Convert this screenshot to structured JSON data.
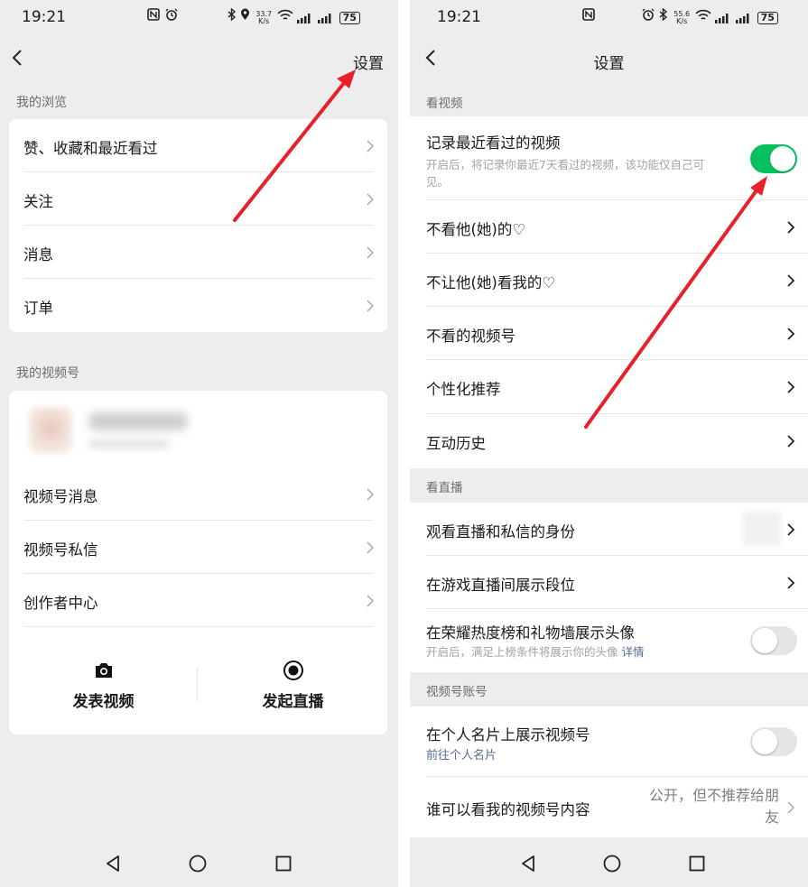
{
  "left": {
    "status": {
      "time": "19:21",
      "net_top": "33.7",
      "net_bottom": "K/s",
      "battery": "75"
    },
    "header": {
      "settings": "设置"
    },
    "browse": {
      "label": "我的浏览",
      "items": [
        {
          "label": "赞、收藏和最近看过"
        },
        {
          "label": "关注"
        },
        {
          "label": "消息"
        },
        {
          "label": "订单"
        }
      ]
    },
    "channel": {
      "label": "我的视频号",
      "items": [
        {
          "label": "视频号消息"
        },
        {
          "label": "视频号私信"
        },
        {
          "label": "创作者中心"
        }
      ],
      "actions": {
        "post": "发表视频",
        "live": "发起直播"
      }
    }
  },
  "right": {
    "status": {
      "time": "19:21",
      "net_top": "55.6",
      "net_bottom": "K/s",
      "battery": "75"
    },
    "header": {
      "title": "设置"
    },
    "watch_video": {
      "label": "看视频",
      "record": {
        "title": "记录最近看过的视频",
        "desc": "开启后，将记录你最近7天看过的视频，该功能仅自己可见。",
        "enabled": true
      },
      "items": [
        {
          "label": "不看他(她)的♡"
        },
        {
          "label": "不让他(她)看我的♡"
        },
        {
          "label": "不看的视频号"
        },
        {
          "label": "个性化推荐"
        },
        {
          "label": "互动历史"
        }
      ]
    },
    "watch_live": {
      "label": "看直播",
      "identity": "观看直播和私信的身份",
      "rank": "在游戏直播间展示段位",
      "avatar": {
        "title": "在荣耀热度榜和礼物墙展示头像",
        "desc": "开启后，满足上榜条件将展示你的头像",
        "link": "详情",
        "enabled": false
      }
    },
    "account": {
      "label": "视频号账号",
      "show": {
        "title": "在个人名片上展示视频号",
        "link": "前往个人名片",
        "enabled": false
      },
      "who": {
        "title": "谁可以看我的视频号内容",
        "value_line1": "公开，但不推荐给朋",
        "value_line2": "友"
      }
    }
  },
  "colors": {
    "accent_green": "#07c160",
    "arrow_red": "#e8202a",
    "link_blue": "#576b95",
    "background": "#ededed"
  }
}
